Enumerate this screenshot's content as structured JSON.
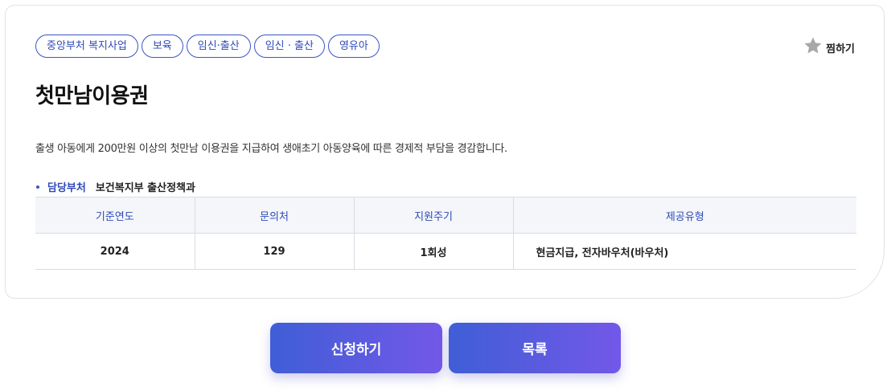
{
  "tags": [
    "중앙부처 복지사업",
    "보육",
    "임신·출산",
    "임신 · 출산",
    "영유아"
  ],
  "favorite": {
    "label": "찜하기",
    "icon": "star-icon",
    "icon_color": "#a8a8a8"
  },
  "title": "첫만남이용권",
  "description": "출생 아동에게 200만원 이상의 첫만남 이용권을 지급하여 생애초기 아동양육에 따른 경제적 부담을 경감합니다.",
  "department": {
    "label": "담당부처",
    "value": "보건복지부 출산정책과"
  },
  "table": {
    "headers": [
      "기준연도",
      "문의처",
      "지원주기",
      "제공유형"
    ],
    "row": [
      "2024",
      "129",
      "1회성",
      "현금지급, 전자바우처(바우처)"
    ]
  },
  "buttons": {
    "apply": "신청하기",
    "list": "목록"
  },
  "colors": {
    "accent": "#2e4ab8",
    "button_from": "#3f5ed6",
    "button_to": "#7358e8"
  }
}
